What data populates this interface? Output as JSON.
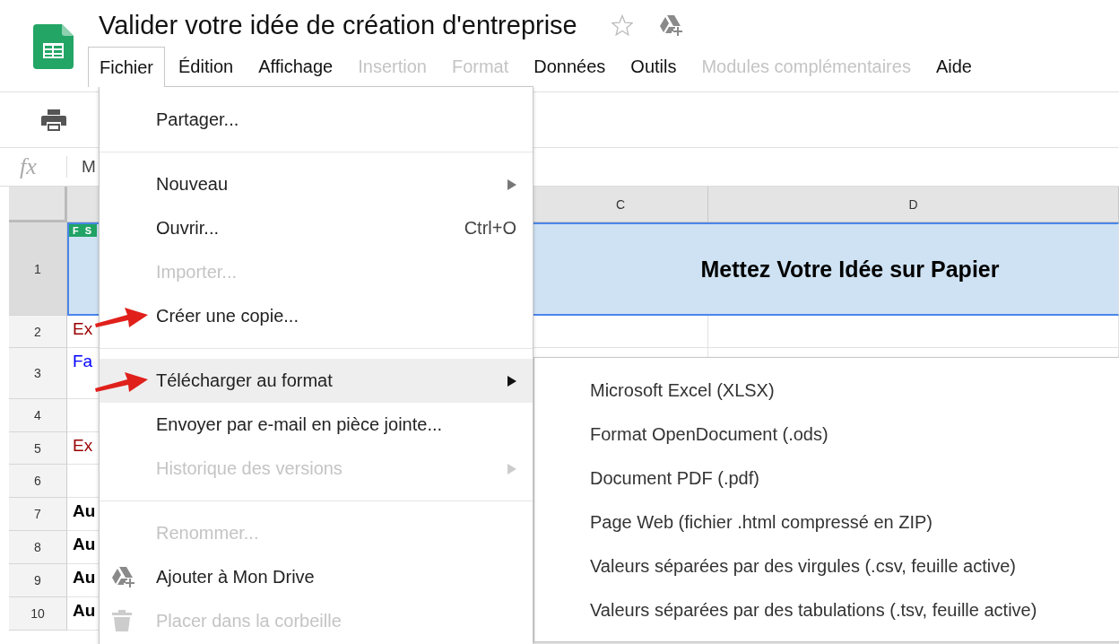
{
  "doc": {
    "title": "Valider votre idée de création d'entreprise",
    "starred": false
  },
  "menubar": [
    {
      "label": "Fichier",
      "selected": true,
      "disabled": false
    },
    {
      "label": "Édition",
      "selected": false,
      "disabled": false
    },
    {
      "label": "Affichage",
      "selected": false,
      "disabled": false
    },
    {
      "label": "Insertion",
      "selected": false,
      "disabled": true
    },
    {
      "label": "Format",
      "selected": false,
      "disabled": true
    },
    {
      "label": "Données",
      "selected": false,
      "disabled": false
    },
    {
      "label": "Outils",
      "selected": false,
      "disabled": false
    },
    {
      "label": "Modules complémentaires",
      "selected": false,
      "disabled": true
    },
    {
      "label": "Aide",
      "selected": false,
      "disabled": false
    }
  ],
  "formula_bar": {
    "label": "fx",
    "content": "M"
  },
  "sheet": {
    "columns": [
      "C",
      "D"
    ],
    "title_cell": "Mettez Votre Idée sur Papier",
    "tag": "F S",
    "rows": [
      {
        "number": "1",
        "text": ""
      },
      {
        "number": "2",
        "text": "Ex",
        "color": "#990000",
        "bold": false
      },
      {
        "number": "3",
        "text": "Fa",
        "color": "#0000ff",
        "bold": false
      },
      {
        "number": "4",
        "text": ""
      },
      {
        "number": "5",
        "text": "Ex",
        "color": "#990000",
        "bold": false
      },
      {
        "number": "6",
        "text": ""
      },
      {
        "number": "7",
        "text": "Au",
        "color": "#000000",
        "bold": true
      },
      {
        "number": "8",
        "text": "Au",
        "color": "#000000",
        "bold": true
      },
      {
        "number": "9",
        "text": "Au",
        "color": "#000000",
        "bold": true
      },
      {
        "number": "10",
        "text": "Au",
        "color": "#000000",
        "bold": true
      }
    ]
  },
  "file_menu": {
    "items": [
      {
        "kind": "item",
        "label": "Partager...",
        "disabled": false,
        "highlighted": false,
        "annotated": false
      },
      {
        "kind": "separator"
      },
      {
        "kind": "item",
        "label": "Nouveau",
        "submenu": true,
        "disabled": false,
        "highlighted": false,
        "annotated": false
      },
      {
        "kind": "item",
        "label": "Ouvrir...",
        "shortcut": "Ctrl+O",
        "disabled": false,
        "highlighted": false,
        "annotated": false
      },
      {
        "kind": "item",
        "label": "Importer...",
        "disabled": true,
        "highlighted": false,
        "annotated": false
      },
      {
        "kind": "item",
        "label": "Créer une copie...",
        "disabled": false,
        "highlighted": false,
        "annotated": true
      },
      {
        "kind": "separator"
      },
      {
        "kind": "item",
        "label": "Télécharger au format",
        "submenu": true,
        "disabled": false,
        "highlighted": true,
        "annotated": true
      },
      {
        "kind": "item",
        "label": "Envoyer par e-mail en pièce jointe...",
        "disabled": false,
        "highlighted": false,
        "annotated": false
      },
      {
        "kind": "item",
        "label": "Historique des versions",
        "submenu": true,
        "disabled": true,
        "highlighted": false,
        "annotated": false
      },
      {
        "kind": "separator"
      },
      {
        "kind": "item",
        "label": "Renommer...",
        "disabled": true,
        "highlighted": false,
        "annotated": false
      },
      {
        "kind": "drive-item",
        "label": "Ajouter à Mon Drive",
        "disabled": false,
        "highlighted": false,
        "annotated": false
      },
      {
        "kind": "trash-item",
        "label": "Placer dans la corbeille",
        "disabled": true,
        "highlighted": false,
        "annotated": false
      }
    ]
  },
  "download_submenu": {
    "items": [
      {
        "label": "Microsoft Excel (XLSX)"
      },
      {
        "label": "Format OpenDocument (.ods)"
      },
      {
        "label": "Document PDF (.pdf)"
      },
      {
        "label": "Page Web (fichier .html compressé en ZIP)"
      },
      {
        "label": "Valeurs séparées par des virgules (.csv, feuille active)"
      },
      {
        "label": "Valeurs séparées par des tabulations (.tsv, feuille active)"
      }
    ]
  }
}
